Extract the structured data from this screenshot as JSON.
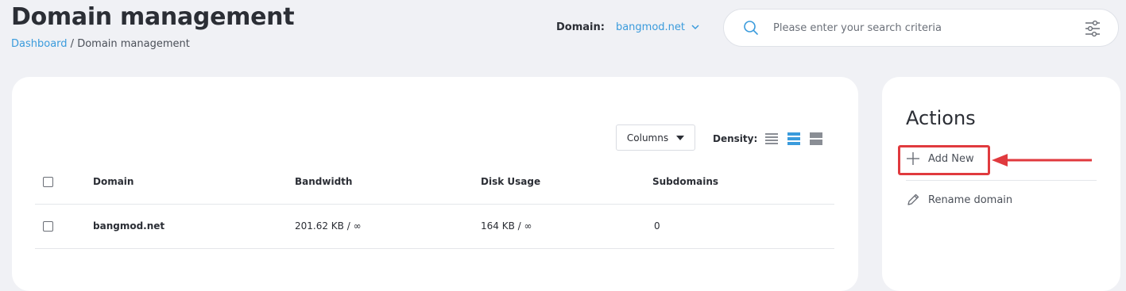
{
  "header": {
    "title": "Domain management",
    "breadcrumb": {
      "home": "Dashboard",
      "separator": " / ",
      "current": "Domain management"
    },
    "domain_label": "Domain:",
    "domain_value": "bangmod.net"
  },
  "search": {
    "placeholder": "Please enter your search criteria",
    "icon": "search-icon",
    "filter_icon": "sliders-icon"
  },
  "toolbar": {
    "columns_label": "Columns",
    "density_label": "Density:",
    "density_options": [
      "compact",
      "standard",
      "comfortable"
    ],
    "density_selected": "standard"
  },
  "table": {
    "columns": [
      "Domain",
      "Bandwidth",
      "Disk Usage",
      "Subdomains"
    ],
    "rows": [
      {
        "domain": "bangmod.net",
        "bandwidth": "201.62 KB / ∞",
        "disk_usage": "164 KB / ∞",
        "subdomains": "0"
      }
    ]
  },
  "actions": {
    "title": "Actions",
    "add_new": "Add New",
    "rename": "Rename domain"
  },
  "colors": {
    "accent": "#3a9bdc",
    "highlight": "#e03a3e",
    "background": "#f0f1f5"
  }
}
